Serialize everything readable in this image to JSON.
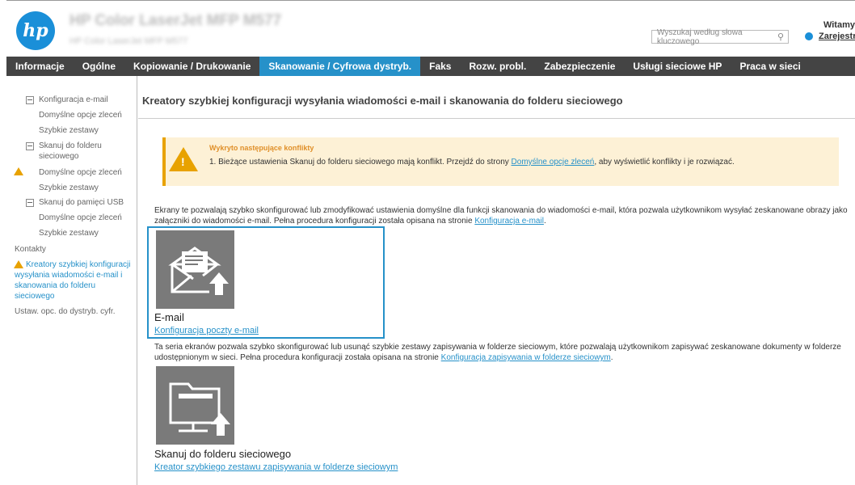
{
  "header": {
    "product_title": "HP Color LaserJet MFP M577",
    "product_subtitle": "HP Color LaserJet MFP M577",
    "welcome": "Witamy",
    "search_placeholder": "Wyszukaj według słowa kluczowego",
    "register_label": "Zarejestruj"
  },
  "nav": {
    "items": [
      "Informacje",
      "Ogólne",
      "Kopiowanie / Drukowanie",
      "Skanowanie / Cyfrowa dystryb.",
      "Faks",
      "Rozw. probl.",
      "Zabezpieczenie",
      "Usługi sieciowe HP",
      "Praca w sieci"
    ],
    "active_index": 3
  },
  "sidebar": {
    "items": [
      "Konfiguracja e-mail",
      "Domyślne opcje zleceń",
      "Szybkie zestawy",
      "Skanuj do folderu",
      "sieciowego",
      "Domyślne opcje zleceń",
      "Szybkie zestawy",
      "Skanuj do pamięci USB",
      "Domyślne opcje zleceń",
      "Szybkie zestawy",
      "Kontakty",
      "Kreatory szybkiej konfiguracji",
      "wysyłania wiadomości e-mail i",
      "skanowania do folderu",
      "sieciowego",
      "Ustaw. opc. do dystryb. cyfr."
    ]
  },
  "main": {
    "title": "Kreatory szybkiej konfiguracji wysyłania wiadomości e-mail i skanowania do folderu sieciowego",
    "alert": {
      "title": "Wykryto następujące konflikty",
      "text_before": "1.  Bieżące ustawienia Skanuj do folderu sieciowego mają konflikt. Przejdź do strony ",
      "link": "Domyślne opcje zleceń",
      "text_after": ", aby wyświetlić konflikty i je rozwiązać."
    },
    "intro1_before": "Ekrany te pozwalają szybko skonfigurować lub zmodyfikować ustawienia domyślne dla funkcji skanowania do wiadomości e-mail, która pozwala użytkownikom wysyłać zeskanowane obrazy jako załączniki do wiadomości e-mail. Pełna procedura konfiguracji została opisana na stronie ",
    "intro1_link": "Konfiguracja e-mail",
    "intro1_after": ".",
    "email_tile": {
      "name": "E-mail",
      "link": "Konfiguracja poczty e-mail"
    },
    "intro2_before": "Ta seria ekranów pozwala szybko skonfigurować lub usunąć szybkie zestawy zapisywania w folderze sieciowym, które pozwalają użytkownikom zapisywać zeskanowane dokumenty w folderze udostępnionym w sieci. Pełna procedura konfiguracji została opisana na stronie ",
    "intro2_link": "Konfiguracja zapisywania w folderze sieciowym",
    "intro2_after": ".",
    "folder_tile": {
      "name": "Skanuj do folderu sieciowego",
      "link": "Kreator szybkiego zestawu zapisywania w folderze sieciowym"
    }
  },
  "colors": {
    "accent": "#2691c9",
    "nav_bg": "#444444",
    "warning": "#e8a200",
    "alert_bg": "#fdf1d6"
  }
}
